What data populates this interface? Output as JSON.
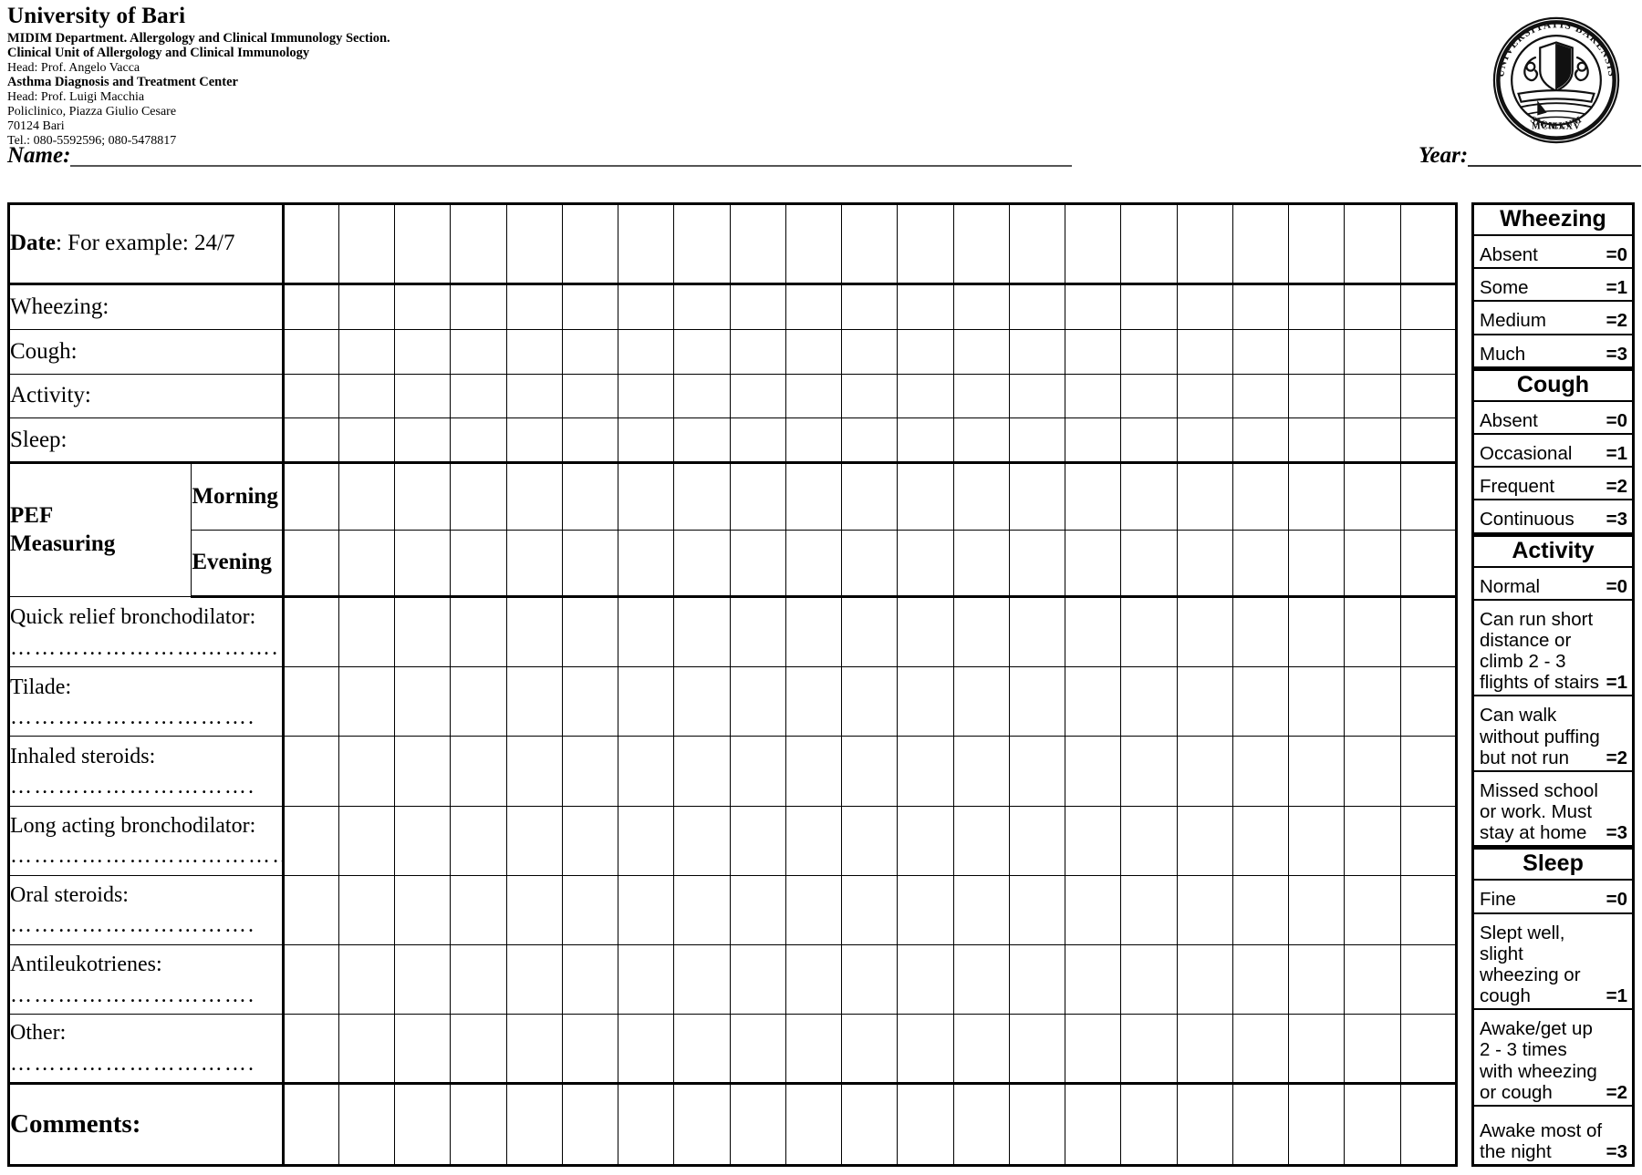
{
  "letterhead": {
    "title": "University of  Bari",
    "line1": "MIDIM Department. Allergology and Clinical Immunology Section.",
    "line2": "Clinical Unit of Allergology and Clinical Immunology",
    "line3": "Head: Prof. Angelo Vacca",
    "line4": "Asthma Diagnosis and Treatment Center",
    "line5": "Head: Prof. Luigi Macchia",
    "line6": "Policlinico, Piazza Giulio Cesare",
    "line7": "70124 Bari",
    "line8": "Tel.: 080-5592596; 080-5478817"
  },
  "seal": {
    "name": "university-seal",
    "outer_text": "SIGILLUM UNIVERSITATIS BARENSIS",
    "year_text": "MCMXXV"
  },
  "fields": {
    "name_label": "Name:",
    "name_value": "",
    "year_label": "Year:",
    "year_value": ""
  },
  "table": {
    "date_label_bold": "Date",
    "date_label_rest": ": For example: 24/7",
    "symptom_rows": [
      {
        "label": "Wheezing:"
      },
      {
        "label": "Cough:"
      },
      {
        "label": "Activity:"
      },
      {
        "label": "Sleep:"
      }
    ],
    "pef": {
      "group_label_line1": "PEF",
      "group_label_line2": "Measuring",
      "morning": "Morning",
      "evening": "Evening"
    },
    "medication_rows": [
      {
        "label": "Quick relief bronchodilator:",
        "dots": "……………………………."
      },
      {
        "label": "Tilade:",
        "dots": "…………………………."
      },
      {
        "label": "Inhaled steroids:",
        "dots": "…………………………."
      },
      {
        "label": "Long acting bronchodilator:",
        "dots": "…………………………………"
      },
      {
        "label": "Oral steroids:",
        "dots": "…………………………."
      },
      {
        "label": "Antileukotrienes:",
        "dots": "…………………………."
      },
      {
        "label": "Other:",
        "dots": "…………………………."
      }
    ],
    "comments_label": "Comments:",
    "data_columns": 21
  },
  "legend": {
    "sections": [
      {
        "title": "Wheezing",
        "rows": [
          {
            "text": "Absent",
            "value": "=0"
          },
          {
            "text": "Some",
            "value": "=1"
          },
          {
            "text": "Medium",
            "value": "=2"
          },
          {
            "text": "Much",
            "value": "=3"
          }
        ]
      },
      {
        "title": "Cough",
        "rows": [
          {
            "text": "Absent",
            "value": "=0"
          },
          {
            "text": "Occasional",
            "value": "=1"
          },
          {
            "text": "Frequent",
            "value": "=2"
          },
          {
            "text": "Continuous",
            "value": "=3"
          }
        ]
      },
      {
        "title": "Activity",
        "rows": [
          {
            "text": "Normal",
            "value": "=0"
          },
          {
            "text": "Can run short distance or climb 2 - 3 flights of stairs",
            "value": "=1"
          },
          {
            "text": "Can walk without puffing but not run",
            "value": "=2"
          },
          {
            "text": "Missed school or work. Must stay at home",
            "value": "=3"
          }
        ]
      },
      {
        "title": "Sleep",
        "rows": [
          {
            "text": "Fine",
            "value": "=0"
          },
          {
            "text": "Slept well, slight wheezing or cough",
            "value": "=1"
          },
          {
            "text": "Awake/get up 2 - 3 times with wheezing or cough",
            "value": "=2"
          },
          {
            "text": "Awake most of the night",
            "value": "=3"
          }
        ]
      }
    ]
  }
}
